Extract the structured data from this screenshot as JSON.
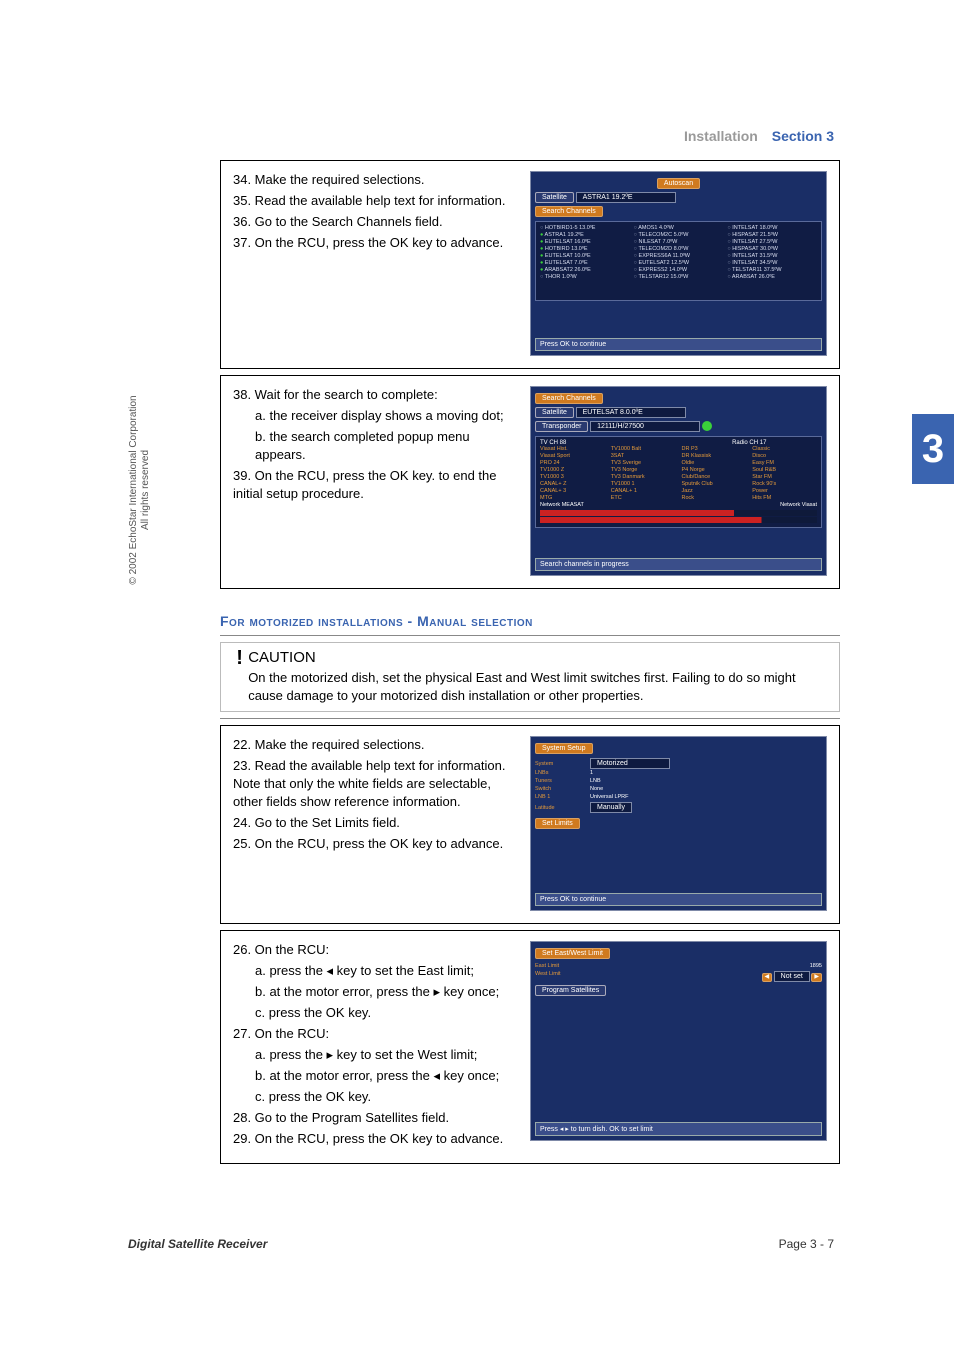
{
  "header": {
    "grey": "Installation",
    "blue": "Section 3"
  },
  "side_number": "3",
  "copyright_line1": "© 2002 EchoStar International Corporation",
  "copyright_line2": "All rights reserved",
  "block1": {
    "s34": "34. Make the required selections.",
    "s35": "35. Read the available help text for information.",
    "s36": "36. Go to the Search Channels field.",
    "s37": "37. On the RCU, press the OK key to advance.",
    "osd": {
      "autoscan": "Autoscan",
      "sat_label": "Satellite",
      "sat_value": "ASTRA1 19.2ºE",
      "search": "Search Channels",
      "hint": "Press OK to continue",
      "items_col1": [
        "HOTBIRD1-5 13.0ºE",
        "ASTRA1 19.2ºE",
        "EUTELSAT 16.0ºE",
        "HOTBIRD 13.0ºE",
        "EUTELSAT 10.0ºE",
        "EUTELSAT 7.0ºE",
        "ARABSAT2 26.0ºE",
        "THOR 1.0ºW"
      ],
      "items_col2": [
        "AMOS1 4.0ºW",
        "TELECOM2C 5.0ºW",
        "NILESAT 7.0ºW",
        "TELECOM2D 8.0ºW",
        "EXPRESS6A 11.0ºW",
        "EUTELSAT2 12.5ºW",
        "EXPRESS2 14.0ºW",
        "TELSTAR12 15.0ºW"
      ],
      "items_col3": [
        "INTELSAT 18.0ºW",
        "HISPASAT 21.5ºW",
        "INTELSAT 27.5ºW",
        "HISPASAT 30.0ºW",
        "INTELSAT 31.5ºW",
        "INTELSAT 34.5ºW",
        "TELSTAR11 37.5ºW",
        "ARABSAT 26.0ºE"
      ]
    }
  },
  "block2": {
    "s38": "38. Wait for the search to complete:",
    "s38a": "a.  the receiver display shows a moving dot;",
    "s38b": "b.  the search completed popup menu appears.",
    "s39": "39. On the RCU, press the OK key. to end the initial setup procedure.",
    "osd": {
      "search": "Search Channels",
      "sat_label": "Satellite",
      "sat_value": "EUTELSAT 8.0.0ºE",
      "tp_label": "Transponder",
      "tp_value": "12111/H/27500",
      "tv_hdr": "TV CH 88",
      "radio_hdr": "Radio CH 17",
      "tv1": [
        "Viasat Hist.",
        "TV1000 Balt",
        "",
        "",
        "Viasat Sport",
        "3SAT",
        "",
        "",
        "PRO 24",
        "TV3 Sverige",
        "",
        "",
        "TV1000 Z",
        "TV3 Norge",
        "",
        "",
        "TV1000 3",
        "TV3 Danmark",
        "",
        "",
        "CANAL+ Z",
        "TV1000 1",
        "",
        "",
        "CANAL+ 3",
        "CANAL+ 1",
        "",
        "",
        "MTG",
        "ETC",
        ""
      ],
      "radio1": [
        "DR P3",
        "",
        "Classic",
        "DR Klassisk",
        "",
        "Disco",
        "Oldie",
        "",
        "Easy FM",
        "P4 Norge",
        "",
        "Soul R&B",
        "Club/Dance",
        "",
        "Star FM",
        "Sputnik Club",
        "",
        "Rock 90's",
        "Jazz",
        "",
        "Power",
        "Rock",
        "",
        "Hits FM"
      ],
      "left_label": "Network MEASAT",
      "right_label": "Network Viasat",
      "hint": "Search channels in progress"
    }
  },
  "section_title": "For motorized installations - Manual selection",
  "caution": {
    "title": "CAUTION",
    "text": "On the motorized dish, set the physical East and West limit switches first. Failing to do so might cause damage to your motorized dish installation or other properties."
  },
  "block3": {
    "s22": "22. Make the required selections.",
    "s23": "23. Read the available help text for information. Note that only the white fields are selectable, other fields show reference information.",
    "s24": "24. Go to the Set Limits field.",
    "s25": "25. On the RCU, press the OK key to advance.",
    "osd": {
      "title": "System Setup",
      "right": "Motorized",
      "rows_l": [
        "System",
        "LNBs",
        "Tuners",
        "Switch",
        "LNB 1",
        "Latitude"
      ],
      "rows_r": [
        "Motorized",
        "1",
        "LNB",
        "None",
        "Universal LPRF",
        "Manually"
      ],
      "set_limits": "Set Limits",
      "hint": "Press OK to continue"
    }
  },
  "block4": {
    "s26": "26. On the RCU:",
    "s26a": "a.  press the ◂ key to set the East limit;",
    "s26b": "b.  at the motor error, press the ▸ key once;",
    "s26c": "c.  press the OK key.",
    "s27": "27. On the RCU:",
    "s27a": "a.  press the ▸ key to set the West limit;",
    "s27b": "b.  at the motor error, press the ◂ key once;",
    "s27c": "c.  press the OK key.",
    "s28": "28. Go to the Program Satellites field.",
    "s29": "29. On the RCU, press the OK key to advance.",
    "osd": {
      "title": "Set East/West Limit",
      "east": "East Limit",
      "west": "West Limit",
      "east_v": "1895",
      "west_v": "Not set",
      "prog": "Program Satellites",
      "hint": "Press ◂ ▸ to turn dish. OK to set limit"
    }
  },
  "footer": {
    "title": "Digital Satellite Receiver",
    "page": "Page 3 - 7"
  }
}
